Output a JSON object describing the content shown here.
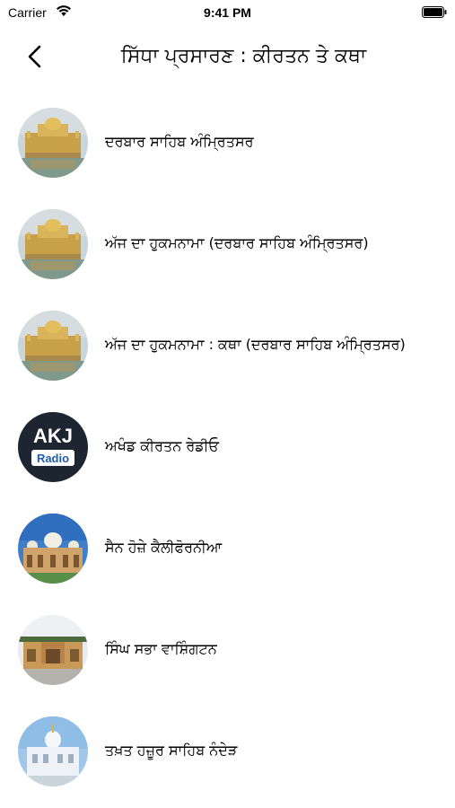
{
  "status_bar": {
    "carrier": "Carrier",
    "time": "9:41 PM"
  },
  "nav": {
    "title": "ਸਿੱਧਾ ਪ੍ਰਸਾਰਣ : ਕੀਰਤਨ ਤੇ ਕਥਾ"
  },
  "items": [
    {
      "label": "ਦਰਬਾਰ ਸਾਹਿਬ ਅੰਮ੍ਰਿਤਸਰ",
      "thumbnail": "golden-temple"
    },
    {
      "label": "ਅੱਜ ਦਾ ਹੁਕਮਨਾਮਾ (ਦਰਬਾਰ ਸਾਹਿਬ ਅੰਮ੍ਰਿਤਸਰ)",
      "thumbnail": "golden-temple"
    },
    {
      "label": "ਅੱਜ ਦਾ ਹੁਕਮਨਾਮਾ : ਕਥਾ  (ਦਰਬਾਰ ਸਾਹਿਬ ਅੰਮ੍ਰਿਤਸਰ)",
      "thumbnail": "golden-temple"
    },
    {
      "label": "ਅਖੰਡ ਕੀਰਤਨ ਰੇਡੀਓ",
      "thumbnail": "akj-radio-logo",
      "logo_text": {
        "top": "AKJ",
        "bottom": "Radio"
      }
    },
    {
      "label": "ਸੈਨ ਹੋਜ਼ੇ ਕੈਲੀਫੋਰਨੀਆ",
      "thumbnail": "san-jose-gurdwara"
    },
    {
      "label": "ਸਿੰਘ ਸਭਾ ਵਾਸ਼ਿੰਗਟਨ",
      "thumbnail": "washington-gurdwara"
    },
    {
      "label": "ਤਖ਼ਤ ਹਜ਼ੂਰ ਸਾਹਿਬ ਨੰਦੇੜ",
      "thumbnail": "hazur-sahib"
    }
  ],
  "colors": {
    "background": "#ffffff",
    "akj_logo_bg": "#1c2530",
    "akj_radio_blue": "#1e5fa8"
  }
}
